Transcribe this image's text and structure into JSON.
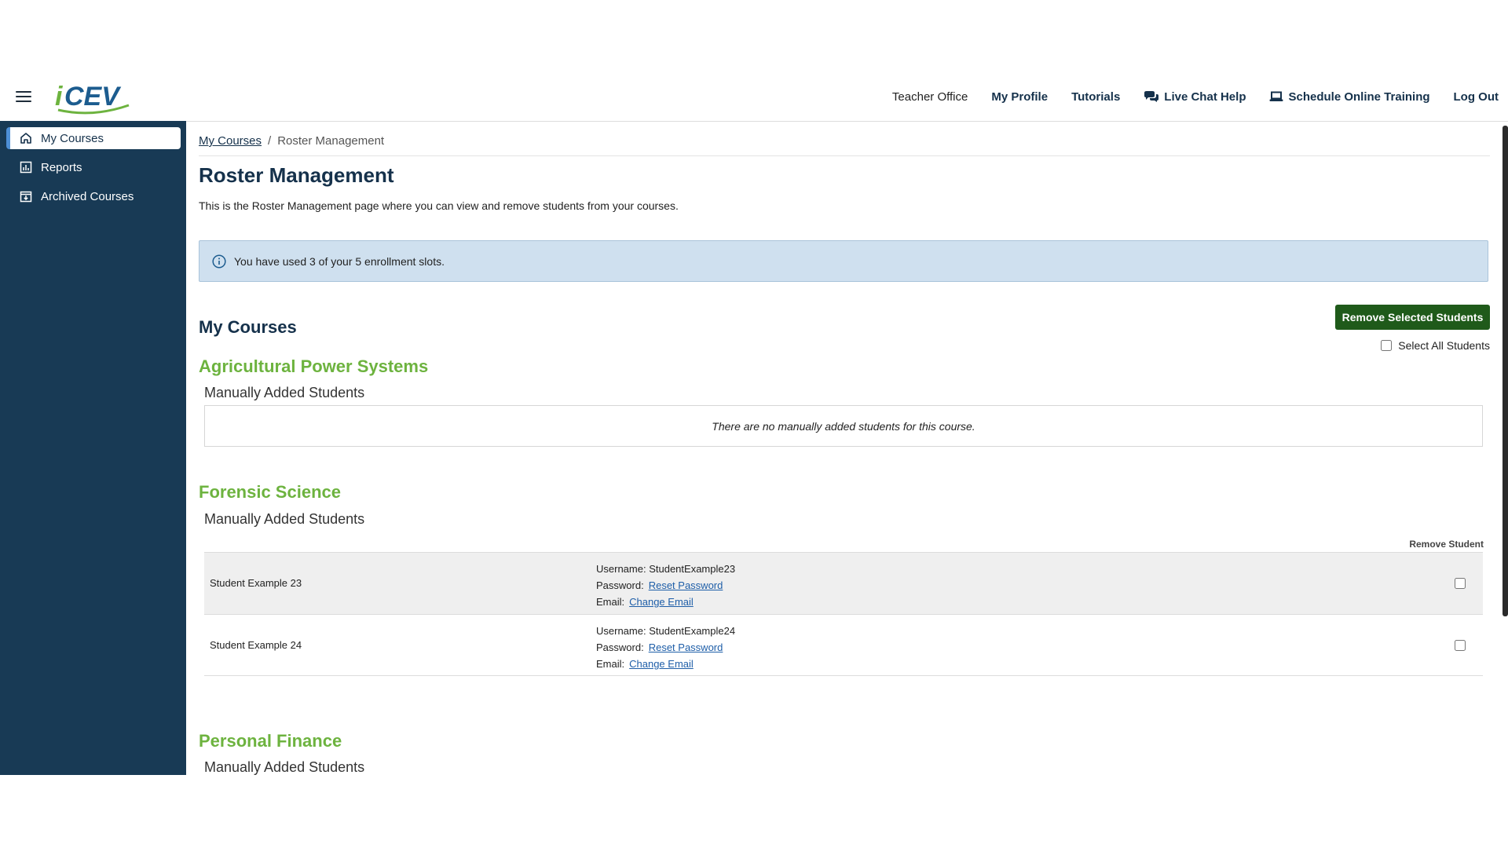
{
  "header": {
    "logo_text": "iCEV",
    "nav": {
      "teacher_office": "Teacher Office",
      "my_profile": "My Profile",
      "tutorials": "Tutorials",
      "live_chat": "Live Chat Help",
      "schedule_training": "Schedule Online Training",
      "log_out": "Log Out"
    }
  },
  "sidebar": {
    "items": [
      {
        "label": "My Courses",
        "icon": "home-icon",
        "active": true
      },
      {
        "label": "Reports",
        "icon": "reports-icon",
        "active": false
      },
      {
        "label": "Archived Courses",
        "icon": "archive-icon",
        "active": false
      }
    ]
  },
  "breadcrumb": {
    "parent": "My Courses",
    "separator": "/",
    "current": "Roster Management"
  },
  "page": {
    "title": "Roster Management",
    "intro": "This is the Roster Management page where you can view and remove students from your courses.",
    "alert": "You have used 3 of your 5 enrollment slots.",
    "section_title": "My Courses",
    "remove_button": "Remove Selected Students",
    "select_all_label": "Select All Students"
  },
  "courses": [
    {
      "title": "Agricultural Power Systems",
      "subtitle": "Manually Added Students",
      "empty_message": "There are no manually added students for this course."
    },
    {
      "title": "Forensic Science",
      "subtitle": "Manually Added Students",
      "column_header": "Remove Student",
      "students": [
        {
          "name": "Student Example 23",
          "username_label": "Username:",
          "username": "StudentExample23",
          "password_label": "Password:",
          "password_link": "Reset Password",
          "email_label": "Email:",
          "email_link": "Change Email"
        },
        {
          "name": "Student Example 24",
          "username_label": "Username:",
          "username": "StudentExample24",
          "password_label": "Password:",
          "password_link": "Reset Password",
          "email_label": "Email:",
          "email_link": "Change Email"
        }
      ]
    },
    {
      "title": "Personal Finance",
      "subtitle": "Manually Added Students"
    }
  ],
  "colors": {
    "navy": "#15314b",
    "sidebar": "#183a55",
    "accent_green": "#6db33f",
    "button_green": "#1f5a1a",
    "alert_bg": "#cfe0ef"
  }
}
